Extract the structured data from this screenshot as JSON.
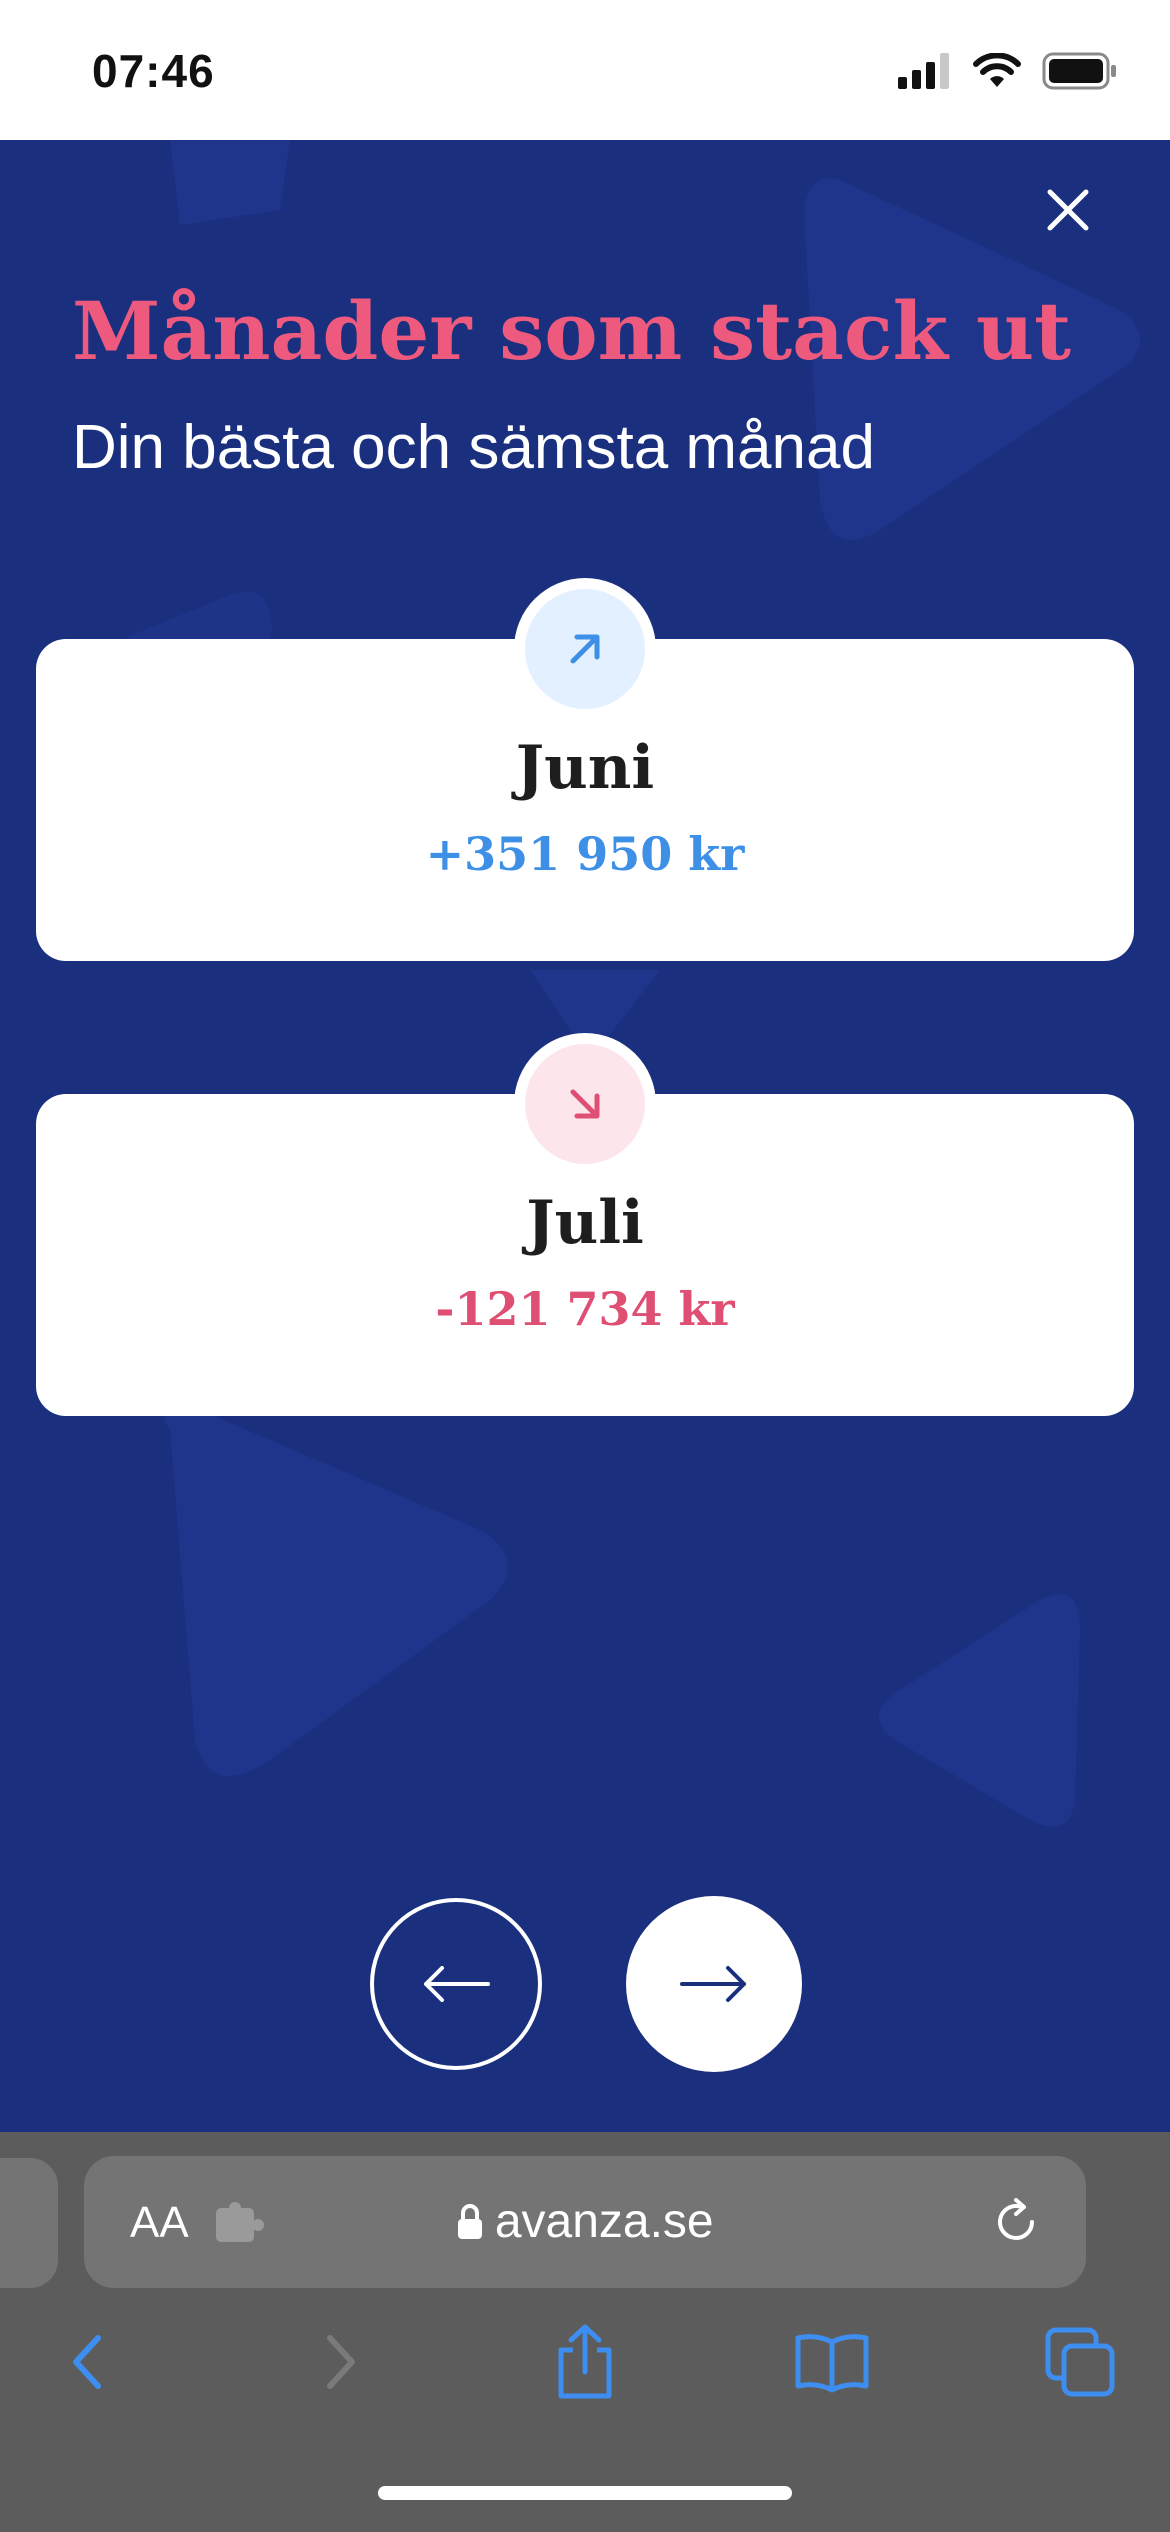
{
  "status_bar": {
    "time": "07:46",
    "icons": [
      "cellular-signal-icon",
      "wifi-icon",
      "battery-icon"
    ]
  },
  "header": {
    "close_icon": "close-icon",
    "title": "Månader som stack ut",
    "subtitle": "Din bästa och sämsta månad"
  },
  "cards": {
    "best": {
      "icon": "arrow-up-right-icon",
      "month": "Juni",
      "amount": "+351 950 kr"
    },
    "worst": {
      "icon": "arrow-down-right-icon",
      "month": "Juli",
      "amount": "-121 734 kr"
    }
  },
  "navigation": {
    "prev_icon": "arrow-left-icon",
    "next_icon": "arrow-right-icon"
  },
  "browser": {
    "text_size_label": "AA",
    "url": "avanza.se",
    "toolbar_icons": [
      "back-icon",
      "forward-icon",
      "share-icon",
      "bookmarks-icon",
      "tabs-icon"
    ]
  },
  "colors": {
    "background": "#1a2f7e",
    "title": "#ee5a7d",
    "positive": "#3e8fe6",
    "negative": "#df4f73",
    "browser_accent": "#3d8ef0"
  }
}
